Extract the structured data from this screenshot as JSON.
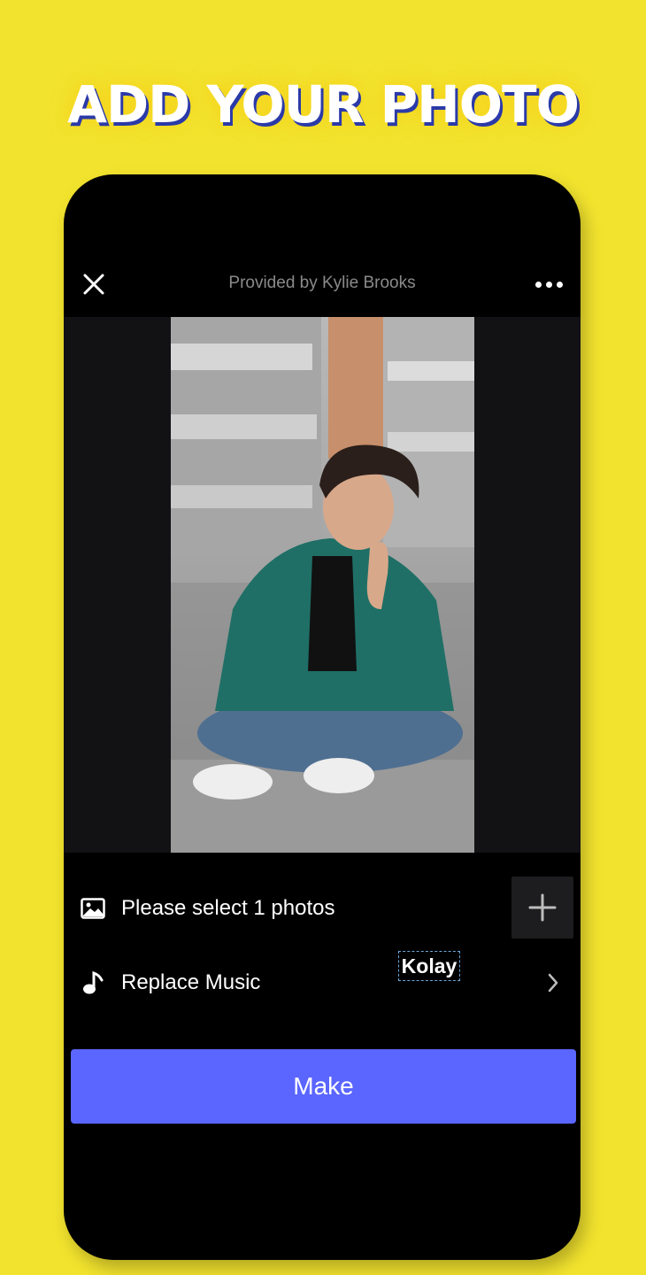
{
  "headline": "ADD YOUR PHOTO",
  "header": {
    "close_icon": "close-icon",
    "provided_by": "Provided by Kylie Brooks",
    "more_icon": "more-icon"
  },
  "preview": {
    "watermark": "Kolay"
  },
  "options": {
    "select_photos": "Please select 1 photos",
    "select_icon": "image-icon",
    "add_icon": "plus-icon",
    "replace_music": "Replace Music",
    "music_icon": "music-note-icon",
    "chevron_icon": "chevron-right-icon"
  },
  "actions": {
    "make_label": "Make"
  },
  "colors": {
    "background": "#f2e32e",
    "accent": "#5a66ff",
    "headline_shadow": "#2b3aa8"
  }
}
